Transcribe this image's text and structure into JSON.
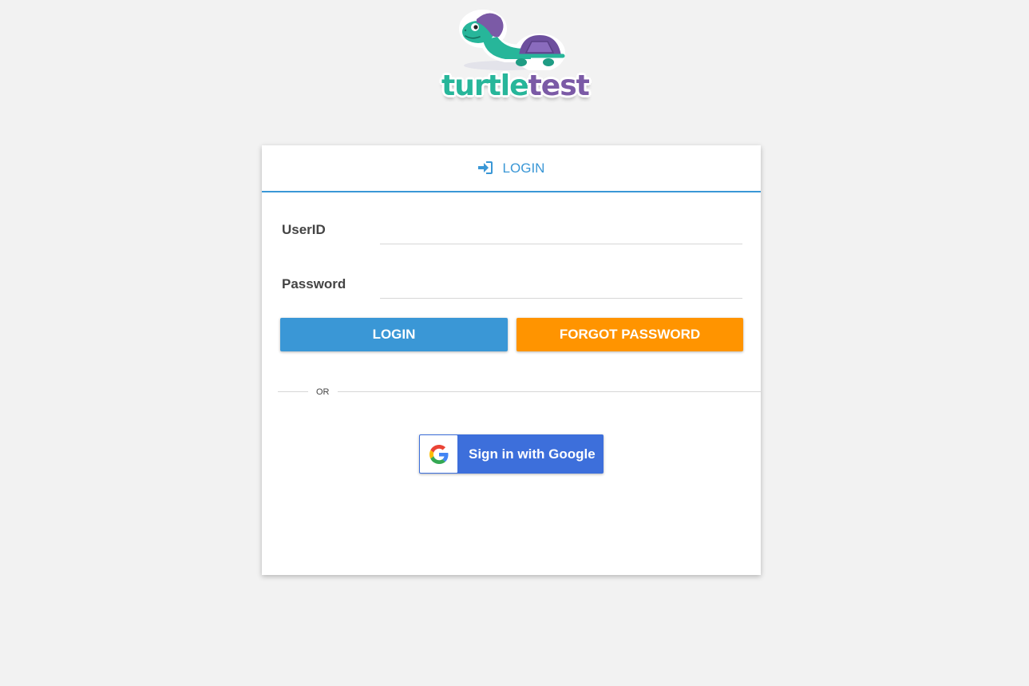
{
  "logo": {
    "text_part1": "turtle",
    "text_part2": "test",
    "colors": {
      "turtle": "#27b69a",
      "test": "#7b5aa6"
    }
  },
  "login_form": {
    "header": {
      "icon": "sign-in-icon",
      "title": "LOGIN"
    },
    "fields": {
      "userid": {
        "label": "UserID",
        "value": ""
      },
      "password": {
        "label": "Password",
        "value": ""
      }
    },
    "buttons": {
      "login": "LOGIN",
      "forgot": "FORGOT PASSWORD"
    },
    "divider_text": "OR",
    "google": {
      "label": "Sign in with Google",
      "icon": "google-g-icon"
    }
  },
  "colors": {
    "accent": "#3a97d6",
    "forgot": "#ff9400",
    "google": "#3d6fdb",
    "background": "#f2f2f2"
  }
}
